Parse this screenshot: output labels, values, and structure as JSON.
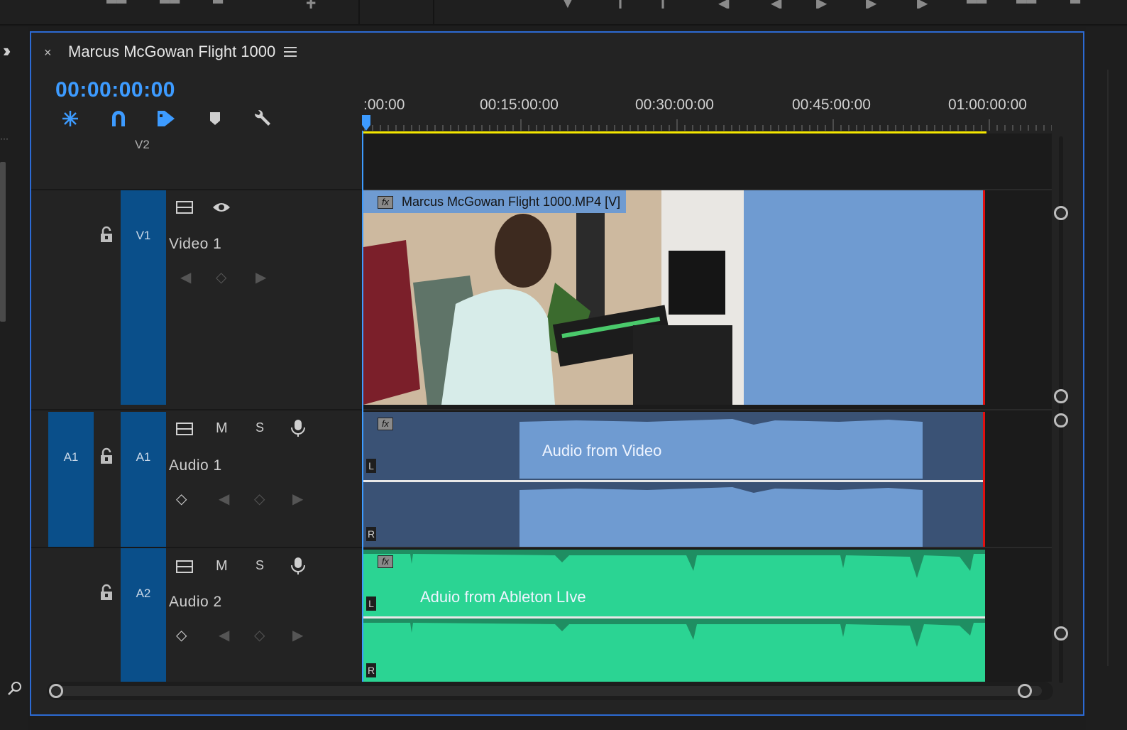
{
  "sequence": {
    "title": "Marcus McGowan Flight 1000",
    "timecode": "00:00:00:00"
  },
  "ruler": {
    "labels": [
      ":00:00",
      "00:15:00:00",
      "00:30:00:00",
      "00:45:00:00",
      "01:00:00:00"
    ]
  },
  "tracks": {
    "v2": {
      "label": "V2"
    },
    "v1": {
      "label": "V1",
      "name": "Video 1"
    },
    "a1": {
      "source": "A1",
      "label": "A1",
      "name": "Audio 1",
      "mute": "M",
      "solo": "S"
    },
    "a2": {
      "label": "A2",
      "name": "Audio 2",
      "mute": "M",
      "solo": "S"
    }
  },
  "clips": {
    "video": {
      "name": "Marcus McGowan Flight 1000.MP4 [V]",
      "fx": "fx"
    },
    "audio1": {
      "name": "Audio from Video",
      "fx": "fx",
      "left": "L",
      "right": "R"
    },
    "audio2": {
      "name": "Aduio from Ableton LIve",
      "fx": "fx",
      "left": "L",
      "right": "R"
    }
  },
  "colors": {
    "accent": "#3d9bff",
    "panel_border": "#2c6ad3",
    "video_clip": "#6f9bd1",
    "audio1_clip": "#6f9bd1",
    "audio2_clip": "#2bd493",
    "work_area": "#f4e600",
    "track_target": "#0a4f8a",
    "end_marker": "#e01010"
  }
}
